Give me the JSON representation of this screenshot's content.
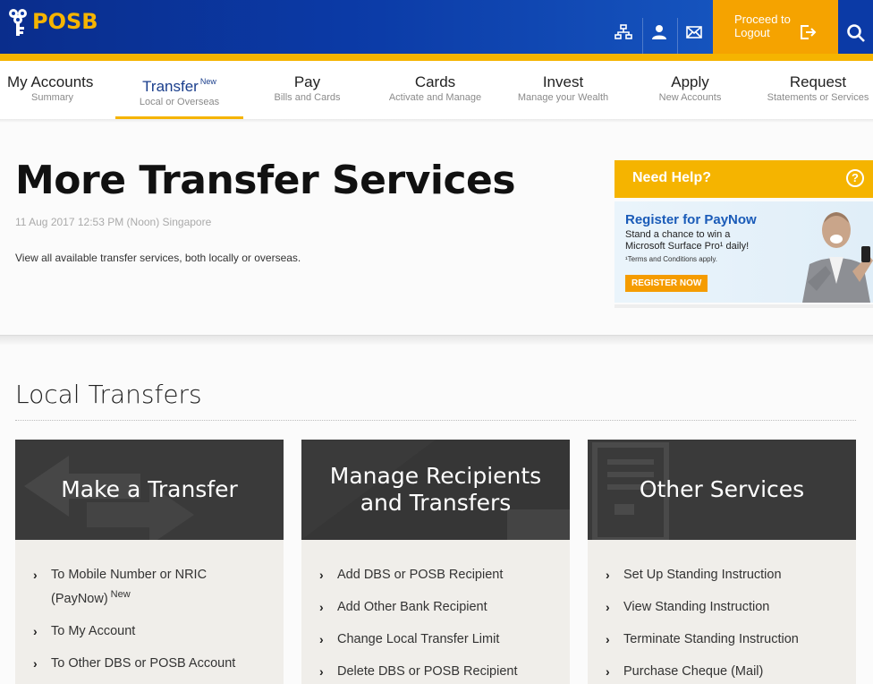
{
  "brand": {
    "name": "POSB"
  },
  "header": {
    "logout_line1": "Proceed to",
    "logout_line2": "Logout"
  },
  "nav": [
    {
      "label": "My Accounts",
      "sub": "Summary"
    },
    {
      "label": "Transfer",
      "sub": "Local or Overseas",
      "badge": "New",
      "active": true
    },
    {
      "label": "Pay",
      "sub": "Bills and Cards"
    },
    {
      "label": "Cards",
      "sub": "Activate and Manage"
    },
    {
      "label": "Invest",
      "sub": "Manage your Wealth"
    },
    {
      "label": "Apply",
      "sub": "New Accounts"
    },
    {
      "label": "Request",
      "sub": "Statements or Services"
    }
  ],
  "page": {
    "title": "More Transfer Services",
    "timestamp": "11 Aug 2017 12:53 PM (Noon) Singapore",
    "description": "View all available transfer services, both locally or overseas."
  },
  "help": {
    "title": "Need Help?",
    "q_mark": "?"
  },
  "promo": {
    "title": "Register for PayNow",
    "line1": "Stand a chance to win a",
    "line2": "Microsoft Surface Pro¹ daily!",
    "terms": "¹Terms and Conditions apply.",
    "button": "REGISTER NOW"
  },
  "local": {
    "title": "Local Transfers",
    "cards": [
      {
        "title_line1": "Make a Transfer",
        "title_line2": "",
        "items": [
          {
            "label": "To Mobile Number or NRIC",
            "label2": "(PayNow)",
            "badge": "New"
          },
          {
            "label": "To My Account"
          },
          {
            "label": "To Other DBS or POSB Account"
          }
        ]
      },
      {
        "title_line1": "Manage Recipients",
        "title_line2": "and Transfers",
        "items": [
          {
            "label": "Add DBS or POSB Recipient"
          },
          {
            "label": "Add Other Bank Recipient"
          },
          {
            "label": "Change Local Transfer Limit"
          },
          {
            "label": "Delete DBS or POSB Recipient"
          }
        ]
      },
      {
        "title_line1": "Other Services",
        "title_line2": "",
        "items": [
          {
            "label": "Set Up Standing Instruction"
          },
          {
            "label": "View Standing Instruction"
          },
          {
            "label": "Terminate Standing Instruction"
          },
          {
            "label": "Purchase Cheque (Mail)"
          }
        ]
      }
    ]
  },
  "chevron": "›",
  "colors": {
    "brand_blue": "#0b3aa6",
    "brand_yellow": "#f5b400",
    "logout_orange": "#f5a300",
    "card_dark": "#3a3a3a"
  }
}
